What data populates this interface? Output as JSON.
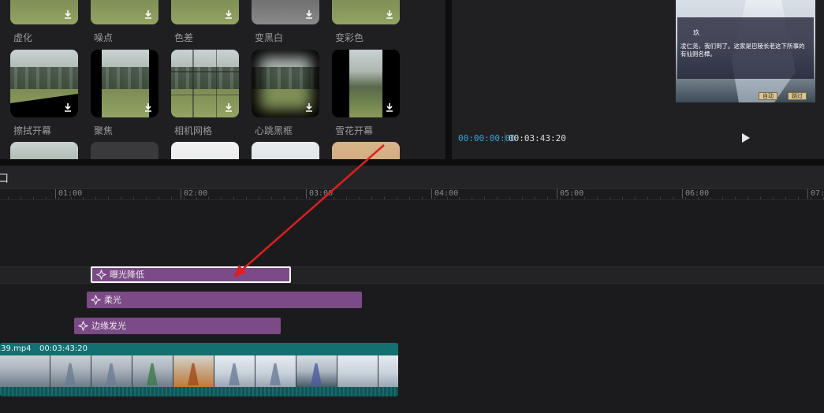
{
  "effects_library": {
    "items": [
      {
        "label": "虚化",
        "icon": "download-icon"
      },
      {
        "label": "噪点",
        "icon": "download-icon"
      },
      {
        "label": "色差",
        "icon": "download-icon"
      },
      {
        "label": "变黑白",
        "icon": "download-icon"
      },
      {
        "label": "变彩色",
        "icon": "download-icon"
      },
      {
        "label": "擦拭开幕",
        "icon": "download-icon"
      },
      {
        "label": "聚焦",
        "icon": "download-icon"
      },
      {
        "label": "相机网格",
        "icon": "download-icon"
      },
      {
        "label": "心跳黑框",
        "icon": "download-icon"
      },
      {
        "label": "雪花开幕",
        "icon": "download-icon"
      }
    ]
  },
  "player": {
    "speaker": "玖",
    "dialog_line1": "凌仁尧，我们到了。这家是巴陵长老这下所事的",
    "dialog_line2": "有仙则名樟。",
    "auto_button": "自动",
    "skip_button": "跳过",
    "time_current": "00:00:00:00",
    "time_total": "00:03:43:20",
    "play_icon": "play-icon"
  },
  "timeline": {
    "toolbar_glyph": "口",
    "ruler_labels": [
      "01:00",
      "02:00",
      "03:00",
      "04:00",
      "05:00",
      "06:00",
      "07:0"
    ],
    "effect_clips": [
      {
        "label": "曝光降低",
        "icon": "effect-star-icon",
        "selected": true
      },
      {
        "label": "柔光",
        "icon": "effect-star-icon",
        "selected": false
      },
      {
        "label": "边缘发光",
        "icon": "effect-star-icon",
        "selected": false
      }
    ],
    "video_clip": {
      "name": ".39.mp4",
      "duration": "00:03:43:20"
    }
  },
  "colors": {
    "accent_time": "#2fa8d8",
    "effect_clip": "#7b4a87",
    "video_clip": "#0e5656",
    "annotation_arrow": "#e01e1e"
  }
}
